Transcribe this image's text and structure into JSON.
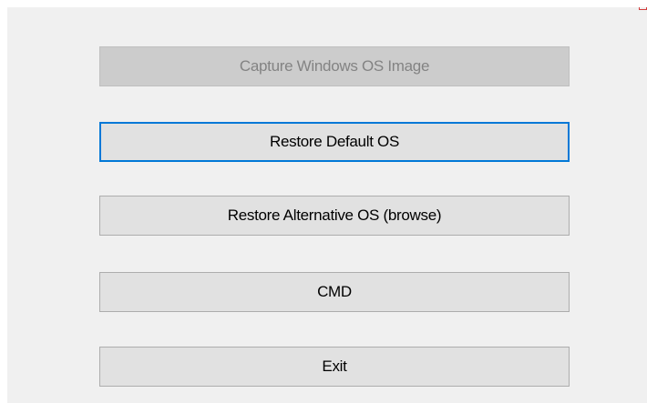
{
  "buttons": {
    "capture": {
      "label": "Capture Windows OS Image",
      "state": "disabled"
    },
    "restore_default": {
      "label": "Restore Default OS",
      "state": "focused"
    },
    "restore_alternative": {
      "label": "Restore Alternative OS (browse)",
      "state": "normal"
    },
    "cmd": {
      "label": "CMD",
      "state": "normal"
    },
    "exit": {
      "label": "Exit",
      "state": "normal"
    }
  },
  "colors": {
    "window_background": "#f0f0f0",
    "button_face": "#e1e1e1",
    "button_border": "#adadad",
    "disabled_face": "#cccccc",
    "disabled_text": "#838383",
    "focus_border": "#0078d7",
    "close_accent": "#d23c3c"
  }
}
